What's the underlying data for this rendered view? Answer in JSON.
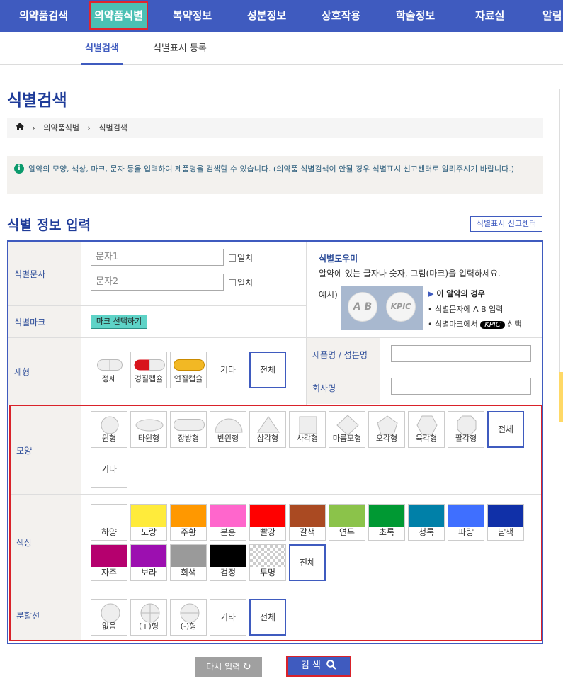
{
  "topnav": {
    "items": [
      "의약품검색",
      "의약품식별",
      "복약정보",
      "성분정보",
      "상호작용",
      "학술정보",
      "자료실",
      "알림"
    ]
  },
  "subnav": {
    "items": [
      "식별검색",
      "식별표시 등록"
    ]
  },
  "page_title": "식별검색",
  "breadcrumb": [
    "의약품식별",
    "식별검색"
  ],
  "notice": "알약의 모양, 색상, 마크, 문자 등을 입력하여 제품명을 검색할 수 있습니다. (의약품 식별검색이 안될 경우 식별표시 신고센터로 알려주시기 바랍니다.)",
  "section_title": "식별 정보 입력",
  "report_button": "식별표시 신고센터",
  "form": {
    "text_label": "식별문자",
    "text1_placeholder": "문자1",
    "text2_placeholder": "문자2",
    "exact_label": "일치",
    "mark_label": "식별마크",
    "mark_button": "마크 선택하기",
    "form_label": "제형",
    "product_label": "제품명 / 성분명",
    "company_label": "회사명",
    "shape_label": "모양",
    "color_label": "색상",
    "line_label": "분할선"
  },
  "helper": {
    "title": "식별도우미",
    "text": "알약에 있는 글자나 숫자, 그림(마크)을 입력하세요.",
    "example": "예시)",
    "pill_text": [
      "A B",
      "KPIC"
    ],
    "case_title": "이 알약의 경우",
    "case1": "• 식별문자에 A B 입력",
    "case2_pre": "• 식별마크에서",
    "case2_mark": "KPIC",
    "case2_post": "선택"
  },
  "form_types": [
    "정제",
    "경질캡슐",
    "연질캡슐",
    "기타",
    "전체"
  ],
  "shapes": [
    "원형",
    "타원형",
    "장방형",
    "반원형",
    "삼각형",
    "사각형",
    "마름모형",
    "오각형",
    "육각형",
    "팔각형",
    "전체",
    "기타"
  ],
  "colors": [
    {
      "name": "하양",
      "hex": "#ffffff"
    },
    {
      "name": "노랑",
      "hex": "#ffeb3b"
    },
    {
      "name": "주황",
      "hex": "#ff9800"
    },
    {
      "name": "분홍",
      "hex": "#ff66cc"
    },
    {
      "name": "빨강",
      "hex": "#ff0000"
    },
    {
      "name": "갈색",
      "hex": "#aa4a22"
    },
    {
      "name": "연두",
      "hex": "#8bc34a"
    },
    {
      "name": "초록",
      "hex": "#009933"
    },
    {
      "name": "청록",
      "hex": "#0080a8"
    },
    {
      "name": "파랑",
      "hex": "#3f6fff"
    },
    {
      "name": "남색",
      "hex": "#1030a8"
    },
    {
      "name": "자주",
      "hex": "#b5006e"
    },
    {
      "name": "보라",
      "hex": "#9c0fb0"
    },
    {
      "name": "회색",
      "hex": "#9a9a9a"
    },
    {
      "name": "검정",
      "hex": "#000000"
    },
    {
      "name": "투명",
      "hex": "transparent"
    }
  ],
  "color_all": "전체",
  "lines": [
    "없음",
    "(+)형",
    "(-)형",
    "기타",
    "전체"
  ],
  "buttons": {
    "reset": "다시 입력",
    "search": "검 색"
  }
}
